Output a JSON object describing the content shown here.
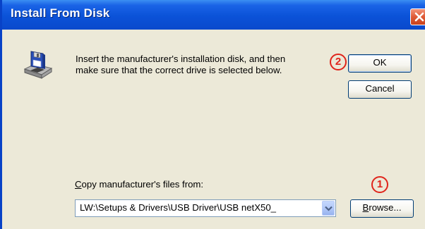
{
  "window": {
    "title": "Install From Disk"
  },
  "message": "Insert the manufacturer's installation disk, and then\nmake sure that the correct drive is selected below.",
  "buttons": {
    "ok": "OK",
    "cancel": "Cancel",
    "browse_mnemonic": "B",
    "browse_rest": "rowse..."
  },
  "copy_from": {
    "label_mnemonic": "C",
    "label_rest": "opy manufacturer's files from:",
    "value": "LW:\\Setups & Drivers\\USB Driver\\USB netX50_"
  },
  "annotations": {
    "step1": "1",
    "step2": "2"
  },
  "colors": {
    "titlebar": "#0b52d8",
    "dialog_bg": "#ECE9D8",
    "annotation": "#e0241b",
    "close_button": "#de5a36"
  },
  "icons": {
    "dialog": "floppy-disk-drive-icon",
    "close": "close-icon",
    "dropdown": "chevron-down-icon"
  }
}
